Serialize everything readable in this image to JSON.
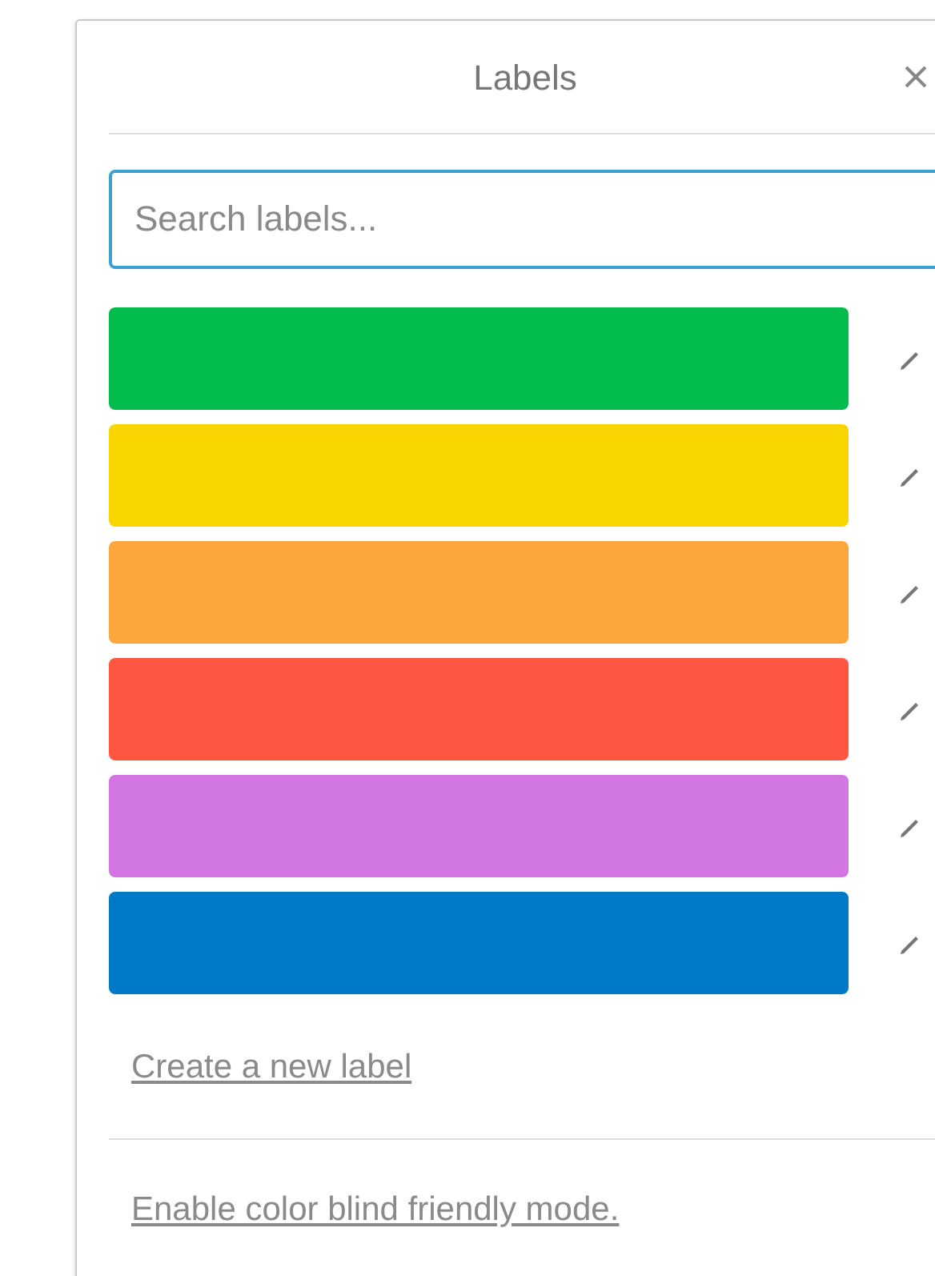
{
  "popover": {
    "title": "Labels"
  },
  "search": {
    "placeholder": "Search labels..."
  },
  "labels": [
    {
      "color": "#02bd4c"
    },
    {
      "color": "#f8d500"
    },
    {
      "color": "#fca63c"
    },
    {
      "color": "#fe5640"
    },
    {
      "color": "#d277e1"
    },
    {
      "color": "#0079c6"
    }
  ],
  "create_link": "Create a new label",
  "colorblind_link": "Enable color blind friendly mode."
}
